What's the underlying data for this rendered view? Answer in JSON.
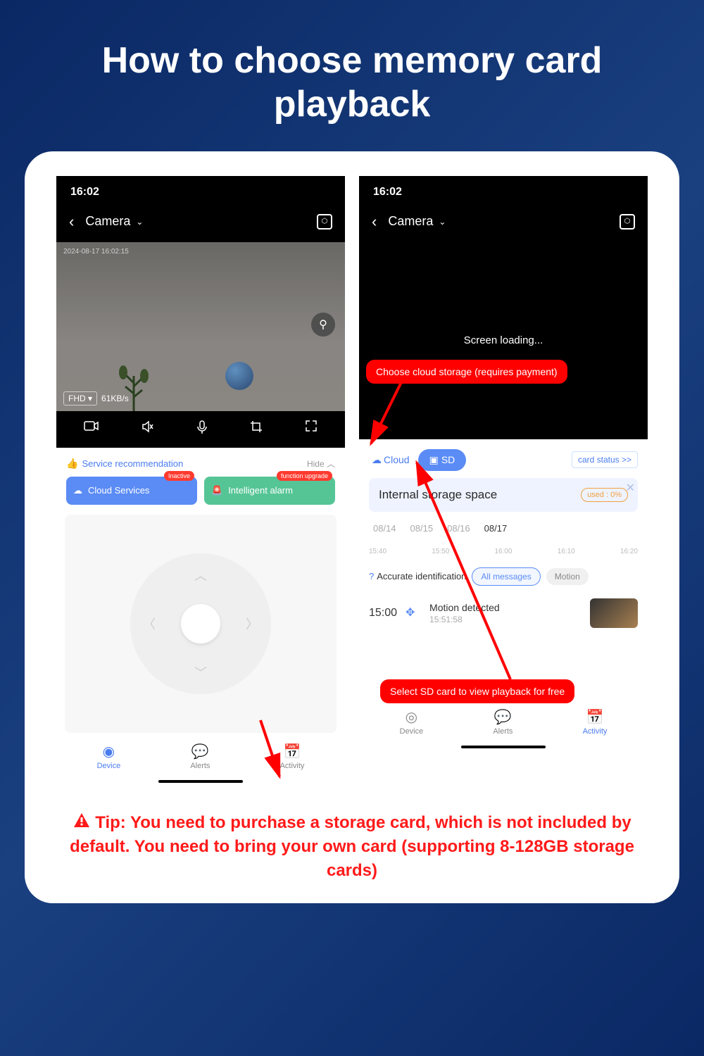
{
  "title": "How to choose memory card playback",
  "phone1": {
    "time": "16:02",
    "camera_label": "Camera",
    "video_timestamp": "2024-08-17 16:02:15",
    "fhd": "FHD",
    "bitrate": "61KB/s",
    "service_recommendation": "Service recommendation",
    "hide": "Hide",
    "cloud_services": "Cloud Services",
    "cloud_badge": "Inactive",
    "intelligent_alarm": "Intelligent alarm",
    "alarm_badge": "function upgrade",
    "nav": {
      "device": "Device",
      "alerts": "Alerts",
      "activity": "Activity"
    }
  },
  "phone2": {
    "time": "16:02",
    "camera_label": "Camera",
    "loading_text": "Screen loading...",
    "cloud_tab": "Cloud",
    "sd_tab": "SD",
    "card_status": "card status >>",
    "storage_title": "Internal storage space",
    "used_label": "used :",
    "used_pct": "0%",
    "dates": [
      "08/14",
      "08/15",
      "08/16",
      "08/17"
    ],
    "times": [
      "15:40",
      "15:50",
      "16:00",
      "16:10",
      "16:20"
    ],
    "accurate": "Accurate identification",
    "filter_all": "All messages",
    "filter_motion": "Motion",
    "event": {
      "time": "15:00",
      "title": "Motion detected",
      "sub": "15:51:58"
    },
    "nav": {
      "device": "Device",
      "alerts": "Alerts",
      "activity": "Activity"
    }
  },
  "callout_cloud": "Choose cloud storage (requires payment)",
  "callout_sd": "Select SD card to view playback for free",
  "tip": "Tip: You need to purchase a storage card, which is not included by default. You need to bring your own card (supporting 8-128GB storage cards)"
}
